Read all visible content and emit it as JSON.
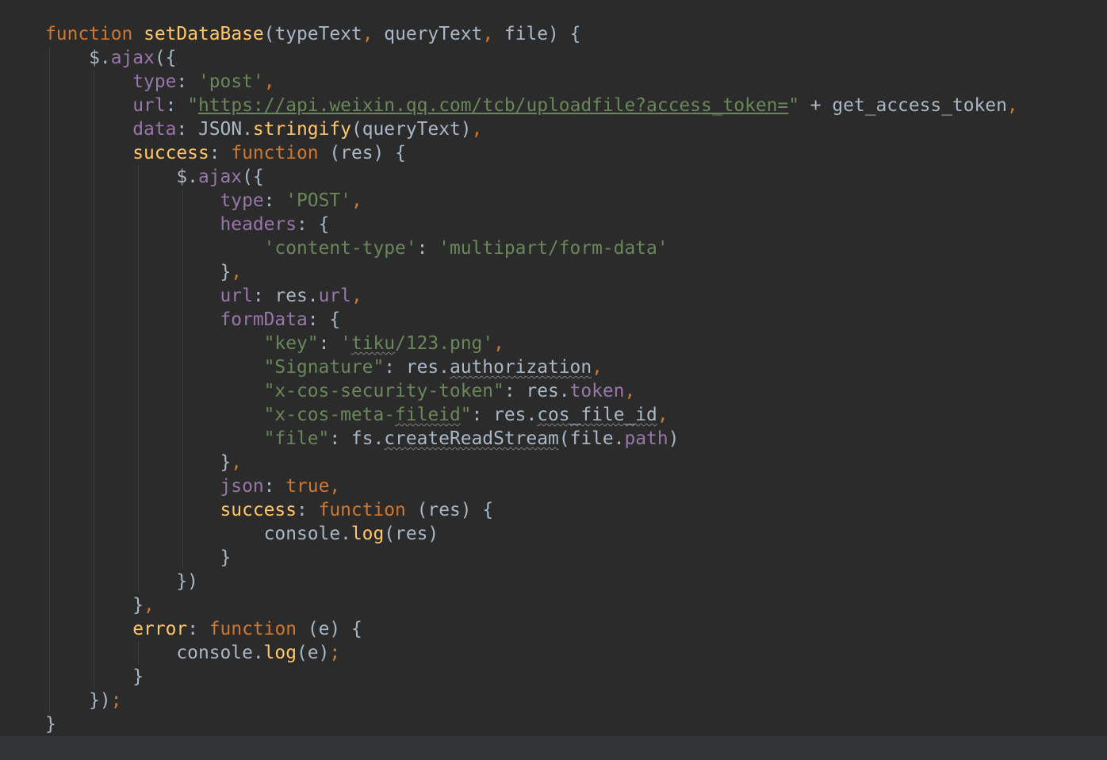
{
  "editor": {
    "lines": [
      [
        {
          "t": "function",
          "c": "kw"
        },
        {
          "t": " ",
          "c": "plain"
        },
        {
          "t": "setDataBase",
          "c": "fn"
        },
        {
          "t": "(typeText",
          "c": "plain"
        },
        {
          "t": ", ",
          "c": "kw"
        },
        {
          "t": "queryText",
          "c": "plain"
        },
        {
          "t": ", ",
          "c": "kw"
        },
        {
          "t": "file) {",
          "c": "plain"
        }
      ],
      [
        {
          "t": "    $.",
          "c": "plain"
        },
        {
          "t": "ajax",
          "c": "prop"
        },
        {
          "t": "({",
          "c": "plain"
        }
      ],
      [
        {
          "t": "        ",
          "c": "plain"
        },
        {
          "t": "type",
          "c": "prop"
        },
        {
          "t": ": ",
          "c": "plain"
        },
        {
          "t": "'post'",
          "c": "str"
        },
        {
          "t": ",",
          "c": "kw"
        }
      ],
      [
        {
          "t": "        ",
          "c": "plain"
        },
        {
          "t": "url",
          "c": "prop"
        },
        {
          "t": ": ",
          "c": "plain"
        },
        {
          "t": "\"",
          "c": "str"
        },
        {
          "t": "https://api.weixin.qq.com/tcb/uploadfile?access_token=",
          "c": "str link"
        },
        {
          "t": "\"",
          "c": "str"
        },
        {
          "t": " + get_access_token",
          "c": "plain"
        },
        {
          "t": ",",
          "c": "kw"
        }
      ],
      [
        {
          "t": "        ",
          "c": "plain"
        },
        {
          "t": "data",
          "c": "prop"
        },
        {
          "t": ": JSON.",
          "c": "plain"
        },
        {
          "t": "stringify",
          "c": "fn"
        },
        {
          "t": "(queryText)",
          "c": "plain"
        },
        {
          "t": ",",
          "c": "kw"
        }
      ],
      [
        {
          "t": "        ",
          "c": "plain"
        },
        {
          "t": "success",
          "c": "fn"
        },
        {
          "t": ": ",
          "c": "plain"
        },
        {
          "t": "function",
          "c": "kw"
        },
        {
          "t": " (res) {",
          "c": "plain"
        }
      ],
      [
        {
          "t": "            $.",
          "c": "plain"
        },
        {
          "t": "ajax",
          "c": "prop"
        },
        {
          "t": "({",
          "c": "plain"
        }
      ],
      [
        {
          "t": "                ",
          "c": "plain"
        },
        {
          "t": "type",
          "c": "prop"
        },
        {
          "t": ": ",
          "c": "plain"
        },
        {
          "t": "'POST'",
          "c": "str"
        },
        {
          "t": ",",
          "c": "kw"
        }
      ],
      [
        {
          "t": "                ",
          "c": "plain"
        },
        {
          "t": "headers",
          "c": "prop"
        },
        {
          "t": ": {",
          "c": "plain"
        }
      ],
      [
        {
          "t": "                    ",
          "c": "plain"
        },
        {
          "t": "'content-type'",
          "c": "str"
        },
        {
          "t": ": ",
          "c": "plain"
        },
        {
          "t": "'multipart/form-data'",
          "c": "str"
        }
      ],
      [
        {
          "t": "                }",
          "c": "plain"
        },
        {
          "t": ",",
          "c": "kw"
        }
      ],
      [
        {
          "t": "                ",
          "c": "plain"
        },
        {
          "t": "url",
          "c": "prop"
        },
        {
          "t": ": res.",
          "c": "plain"
        },
        {
          "t": "url",
          "c": "prop"
        },
        {
          "t": ",",
          "c": "kw"
        }
      ],
      [
        {
          "t": "                ",
          "c": "plain"
        },
        {
          "t": "formData",
          "c": "prop"
        },
        {
          "t": ": {",
          "c": "plain"
        }
      ],
      [
        {
          "t": "                    ",
          "c": "plain"
        },
        {
          "t": "\"key\"",
          "c": "str"
        },
        {
          "t": ": ",
          "c": "plain"
        },
        {
          "t": "'",
          "c": "str"
        },
        {
          "t": "tiku",
          "c": "str typo"
        },
        {
          "t": "/123.png'",
          "c": "str"
        },
        {
          "t": ",",
          "c": "kw"
        }
      ],
      [
        {
          "t": "                    ",
          "c": "plain"
        },
        {
          "t": "\"Signature\"",
          "c": "str"
        },
        {
          "t": ": res.",
          "c": "plain"
        },
        {
          "t": "authorization",
          "c": "plain typo"
        },
        {
          "t": ",",
          "c": "kw"
        }
      ],
      [
        {
          "t": "                    ",
          "c": "plain"
        },
        {
          "t": "\"x-cos-security-token\"",
          "c": "str"
        },
        {
          "t": ": res.",
          "c": "plain"
        },
        {
          "t": "token",
          "c": "prop"
        },
        {
          "t": ",",
          "c": "kw"
        }
      ],
      [
        {
          "t": "                    ",
          "c": "plain"
        },
        {
          "t": "\"x-cos-meta-",
          "c": "str"
        },
        {
          "t": "fileid",
          "c": "str typo"
        },
        {
          "t": "\"",
          "c": "str"
        },
        {
          "t": ": res.",
          "c": "plain"
        },
        {
          "t": "cos_file_id",
          "c": "plain typo"
        },
        {
          "t": ",",
          "c": "kw"
        }
      ],
      [
        {
          "t": "                    ",
          "c": "plain"
        },
        {
          "t": "\"file\"",
          "c": "str"
        },
        {
          "t": ": fs.",
          "c": "plain"
        },
        {
          "t": "createReadStream",
          "c": "plain typo"
        },
        {
          "t": "(file.",
          "c": "plain"
        },
        {
          "t": "path",
          "c": "prop"
        },
        {
          "t": ")",
          "c": "plain"
        }
      ],
      [
        {
          "t": "                }",
          "c": "plain"
        },
        {
          "t": ",",
          "c": "kw"
        }
      ],
      [
        {
          "t": "                ",
          "c": "plain"
        },
        {
          "t": "json",
          "c": "prop"
        },
        {
          "t": ": ",
          "c": "plain"
        },
        {
          "t": "true",
          "c": "kw"
        },
        {
          "t": ",",
          "c": "kw"
        }
      ],
      [
        {
          "t": "                ",
          "c": "plain"
        },
        {
          "t": "success",
          "c": "fn"
        },
        {
          "t": ": ",
          "c": "plain"
        },
        {
          "t": "function",
          "c": "kw"
        },
        {
          "t": " (res) {",
          "c": "plain"
        }
      ],
      [
        {
          "t": "                    console.",
          "c": "plain"
        },
        {
          "t": "log",
          "c": "fn"
        },
        {
          "t": "(res)",
          "c": "plain"
        }
      ],
      [
        {
          "t": "                }",
          "c": "plain"
        }
      ],
      [
        {
          "t": "            })",
          "c": "plain"
        }
      ],
      [
        {
          "t": "        }",
          "c": "plain"
        },
        {
          "t": ",",
          "c": "kw"
        }
      ],
      [
        {
          "t": "        ",
          "c": "plain"
        },
        {
          "t": "error",
          "c": "fn"
        },
        {
          "t": ": ",
          "c": "plain"
        },
        {
          "t": "function",
          "c": "kw"
        },
        {
          "t": " (e) {",
          "c": "plain"
        }
      ],
      [
        {
          "t": "            console.",
          "c": "plain"
        },
        {
          "t": "log",
          "c": "fn"
        },
        {
          "t": "(e)",
          "c": "plain"
        },
        {
          "t": ";",
          "c": "kw"
        }
      ],
      [
        {
          "t": "        }",
          "c": "plain"
        }
      ],
      [
        {
          "t": "    })",
          "c": "plain"
        },
        {
          "t": ";",
          "c": "kw"
        }
      ],
      [
        {
          "t": "}",
          "c": "plain"
        }
      ]
    ]
  },
  "theme": {
    "background": "#2b2b2b",
    "keyword": "#cc7832",
    "function": "#ffc66d",
    "property": "#9876aa",
    "string": "#6a8759",
    "default": "#a9b7c6"
  }
}
